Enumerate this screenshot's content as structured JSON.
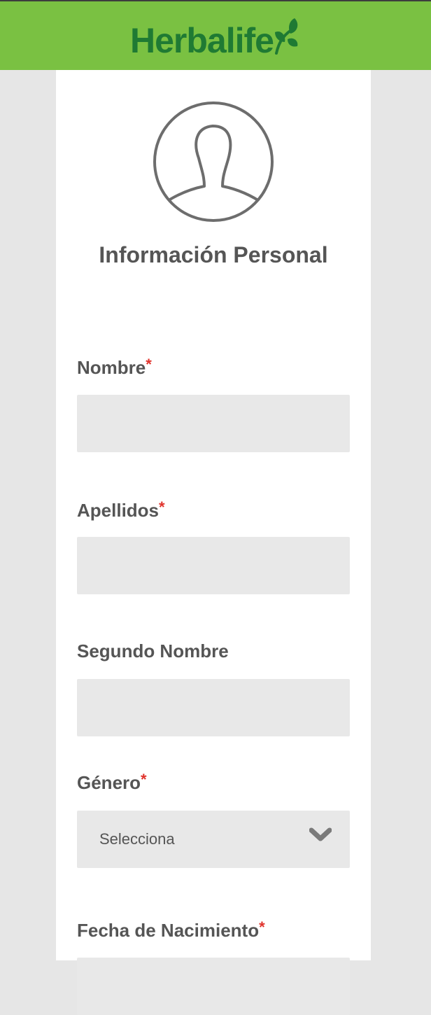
{
  "header": {
    "logo_text": "Herbalife",
    "logo_color": "#1f7a33",
    "bar_color": "#7ac142"
  },
  "profile": {
    "avatar_icon": "user-silhouette-icon",
    "title": "Información Personal"
  },
  "form": {
    "required_marker": "*",
    "fields": [
      {
        "label": "Nombre",
        "required": true,
        "value": ""
      },
      {
        "label": "Apellidos",
        "required": true,
        "value": ""
      },
      {
        "label": "Segundo Nombre",
        "required": false,
        "value": ""
      },
      {
        "label": "Género",
        "required": true,
        "selected": "Selecciona",
        "icon": "chevron-down-icon"
      },
      {
        "label": "Fecha de Nacimiento",
        "required": true,
        "value": ""
      }
    ]
  },
  "colors": {
    "required": "#e0322b",
    "label": "#555555",
    "input_bg": "#e8e8e8",
    "page_bg": "#e6e6e6"
  }
}
